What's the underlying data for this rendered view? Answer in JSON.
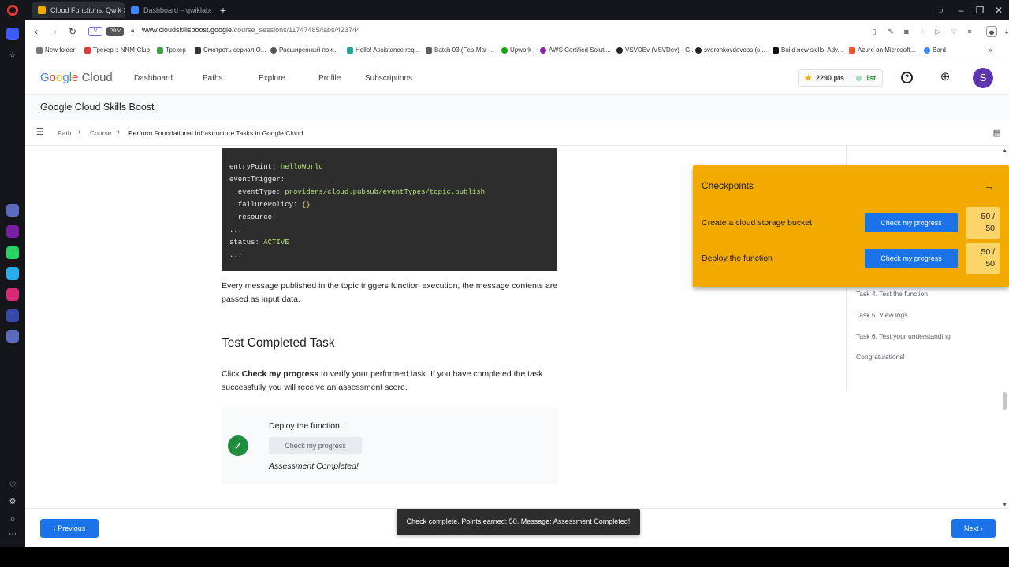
{
  "browser": {
    "tabs": [
      {
        "title": "Cloud Functions: Qwik St"
      },
      {
        "title": "Dashboard – qwiklabs-gcp"
      }
    ],
    "new_tab": "+",
    "window_controls": [
      "⌕",
      "–",
      "❐",
      "✕"
    ],
    "address": {
      "vpn_badge": "V",
      "private_badge": "PRIV",
      "url_host": "www.cloudskillsboost.google",
      "url_path": "/course_sessions/11747485/labs/423744"
    },
    "bookmarks": [
      "New folder",
      "Трекер :: NNM-Club",
      "Трекер",
      "Смотреть сериал О...",
      "Расширенный пои...",
      "Hello! Assistance req...",
      "Batch 03 (Feb-Mar-...",
      "Upwork",
      "AWS Certified Soluti...",
      "VSVDEv (VSVDev) - G...",
      "svoronkovdevops (s...",
      "Build new skills. Adv...",
      "Azure on Microsoft...",
      "Bard"
    ],
    "bookmarks_more": "»"
  },
  "header": {
    "logo_google": [
      "G",
      "o",
      "o",
      "g",
      "l",
      "e"
    ],
    "logo_cloud": "Cloud",
    "nav": [
      "Dashboard",
      "Paths",
      "Explore",
      "Profile",
      "Subscriptions"
    ],
    "points": "2290 pts",
    "rank": "1st",
    "help_glyph": "?",
    "avatar_letter": "S"
  },
  "subheader": {
    "title": "Google Cloud Skills Boost"
  },
  "breadcrumb": {
    "items": [
      "Path",
      "Course",
      "Perform Foundational Infrastructure Tasks in Google Cloud"
    ],
    "sep": "›"
  },
  "code": {
    "lines": [
      {
        "key": "entryPoint: ",
        "val": "helloWorld"
      },
      {
        "key": "eventTrigger:",
        "val": ""
      },
      {
        "key": "  eventType: ",
        "val": "providers/cloud.pubsub/eventTypes/topic.publish"
      },
      {
        "key": "  failurePolicy: ",
        "val": "{}"
      },
      {
        "key": "  resource:",
        "val": ""
      },
      {
        "key": "...",
        "val": ""
      },
      {
        "key": "status: ",
        "val": "ACTIVE"
      },
      {
        "key": "...",
        "val": ""
      }
    ]
  },
  "content": {
    "para1": "Every message published in the topic triggers function execution, the message contents are passed as input data.",
    "heading": "Test Completed Task",
    "para2_pre": "Click ",
    "para2_bold": "Check my progress",
    "para2_post": " to verify your performed task. If you have completed the task successfully you will receive an assessment score.",
    "card": {
      "title": "Deploy the function.",
      "button": "Check my progress",
      "status": "Assessment Completed!"
    }
  },
  "toc": {
    "items": [
      "Task 4. Test the function",
      "Task 5. View logs",
      "Task 6. Test your understanding",
      "Congratulations!"
    ]
  },
  "checkpoints": {
    "title": "Checkpoints",
    "close_glyph": "→",
    "items": [
      {
        "label": "Create a cloud storage bucket",
        "button": "Check my progress",
        "score_top": "50 /",
        "score_bottom": "50"
      },
      {
        "label": "Deploy the function",
        "button": "Check my progress",
        "score_top": "50 /",
        "score_bottom": "50"
      }
    ]
  },
  "footer": {
    "previous": "Previous",
    "next": "Next",
    "toast": "Check complete. Points earned: 50. Message: Assessment Completed!"
  },
  "colors": {
    "accent": "#1a73e8",
    "checkpoints_bg": "#f2a900",
    "success": "#1e8e3e"
  }
}
